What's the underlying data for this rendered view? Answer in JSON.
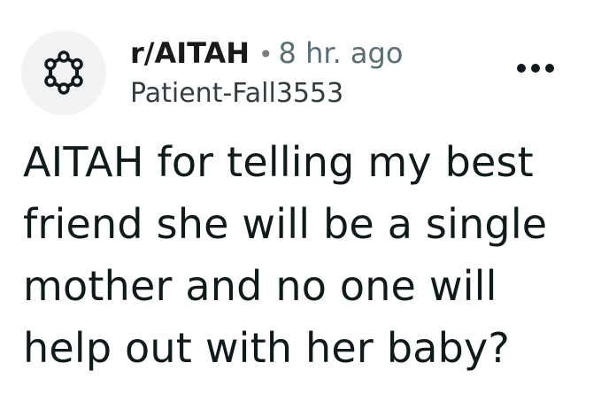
{
  "post": {
    "subreddit": "r/AITAH",
    "separator": "•",
    "time_ago": "8 hr. ago",
    "author": "Patient-Fall3553",
    "title": "AITAH for telling my best friend she will be a single mother and no one will help out with her baby?"
  },
  "icons": {
    "avatar": "community-hexagon-icon",
    "more": "more-options-icon"
  },
  "colors": {
    "background": "#ffffff",
    "avatar_bg": "#f2f3f4",
    "text_primary": "#0f1a1c",
    "text_secondary": "#576f76"
  }
}
